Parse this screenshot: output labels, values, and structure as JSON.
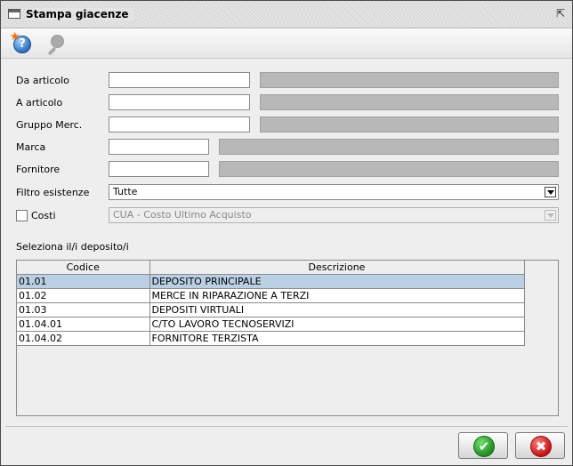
{
  "window": {
    "title": "Stampa giacenze"
  },
  "form": {
    "da_articolo_label": "Da articolo",
    "a_articolo_label": "A articolo",
    "gruppo_label": "Gruppo Merc.",
    "marca_label": "Marca",
    "fornitore_label": "Fornitore",
    "filtro_label": "Filtro esistenze",
    "filtro_value": "Tutte",
    "costi_label": "Costi",
    "costi_checked": false,
    "costi_value": "CUA - Costo Ultimo Acquisto",
    "depositi_label": "Seleziona il/i deposito/i"
  },
  "table": {
    "columns": [
      "Codice",
      "Descrizione"
    ],
    "rows": [
      {
        "codice": "01.01",
        "descrizione": "DEPOSITO PRINCIPALE"
      },
      {
        "codice": "01.02",
        "descrizione": "MERCE IN RIPARAZIONE A TERZI"
      },
      {
        "codice": "01.03",
        "descrizione": "DEPOSITI VIRTUALI"
      },
      {
        "codice": "01.04.01",
        "descrizione": "C/TO LAVORO TECNOSERVIZI"
      },
      {
        "codice": "01.04.02",
        "descrizione": "FORNITORE TERZISTA"
      }
    ],
    "selected_row": 0
  },
  "icons": {
    "window": "window-icon",
    "restore": "restore-icon",
    "help": "help-icon",
    "search": "search-icon",
    "confirm": "checkmark-icon",
    "cancel": "close-icon"
  },
  "colors": {
    "selection": "#b8cfe4",
    "confirm": "#1f8f1f",
    "cancel": "#c81414"
  }
}
